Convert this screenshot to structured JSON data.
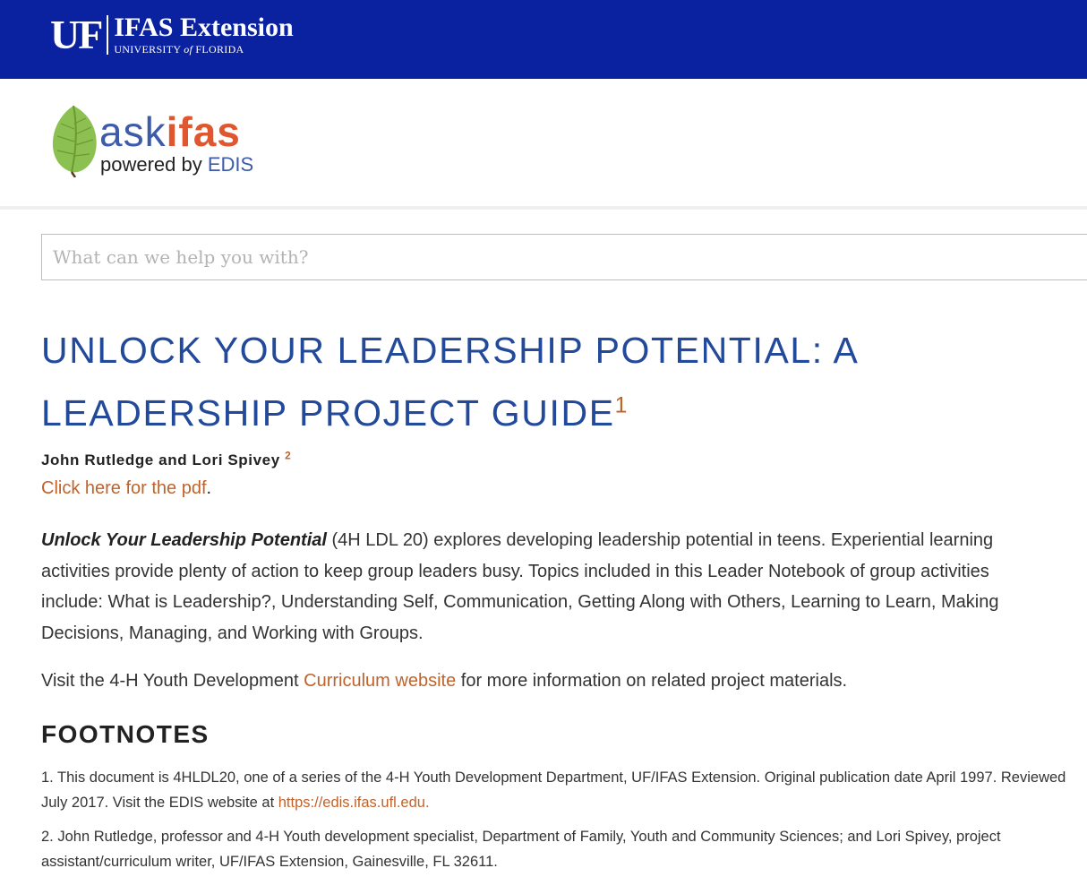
{
  "header": {
    "uf_letters": "UF",
    "extension_title": "IFAS Extension",
    "university_prefix": "UNIVERSITY ",
    "university_of": "of",
    "university_suffix": " FLORIDA",
    "bg_color": "#0a21a0"
  },
  "brand": {
    "ask": "ask",
    "ifas": "ifas",
    "powered_by": "powered by ",
    "edis": "EDIS",
    "leaf_icon": "leaf-icon",
    "colors": {
      "ask": "#3d5ba8",
      "ifas": "#e0562f",
      "leaf": "#8cc152"
    }
  },
  "search": {
    "placeholder": "What can we help you with?",
    "value": ""
  },
  "article": {
    "title": "UNLOCK YOUR LEADERSHIP POTENTIAL: A LEADERSHIP PROJECT GUIDE",
    "title_footnote": "1",
    "authors": "John Rutledge and Lori Spivey ",
    "authors_footnote": "2",
    "pdf_link": "Click here for the pdf",
    "pdf_period": ".",
    "intro_italic": "Unlock Your Leadership Potential",
    "intro_rest": " (4H LDL 20) explores developing leadership potential in teens. Experiential learning activities provide plenty of action to keep group leaders busy. Topics included in this Leader Notebook of group activities include: What is Leadership?, Understanding Self, Communication, Getting Along with Others, Learning to Learn, Making Decisions, Managing, and Working with Groups.",
    "visit_before": "Visit the 4-H Youth Development ",
    "visit_link": "Curriculum website",
    "visit_after": " for more information on related project materials.",
    "link_color": "#c0632b",
    "title_color": "#234a9a"
  },
  "footnotes": {
    "heading": "FOOTNOTES",
    "items": [
      {
        "text": "1. This document is 4HLDL20, one of a series of the 4-H Youth Development Department, UF/IFAS Extension. Original publication date April 1997. Reviewed July 2017. Visit the EDIS website at ",
        "link": "https://edis.ifas.ufl.edu",
        "after": "."
      },
      {
        "text": "2. John Rutledge, professor and 4-H Youth development specialist, Department of Family, Youth and Community Sciences; and Lori Spivey, project assistant/curriculum writer, UF/IFAS Extension, Gainesville, FL 32611."
      }
    ]
  }
}
